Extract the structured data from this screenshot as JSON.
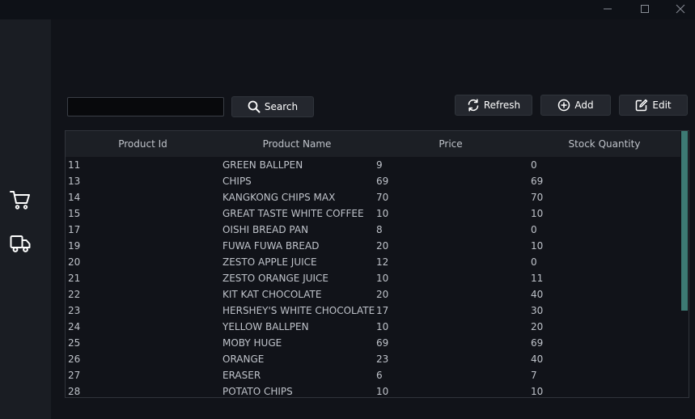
{
  "window_controls": {
    "minimize_icon": "minimize-icon",
    "maximize_icon": "maximize-icon",
    "close_icon": "close-icon"
  },
  "sidebar": {
    "items": [
      {
        "icon": "cart-icon"
      },
      {
        "icon": "truck-icon"
      }
    ]
  },
  "toolbar": {
    "search_value": "",
    "search_label": "Search",
    "refresh_label": "Refresh",
    "add_label": "Add",
    "edit_label": "Edit"
  },
  "table": {
    "columns": [
      "Product Id",
      "Product Name",
      "Price",
      "Stock Quantity"
    ],
    "rows": [
      [
        "11",
        "GREEN BALLPEN",
        "9",
        "0"
      ],
      [
        "13",
        "CHIPS",
        "69",
        "69"
      ],
      [
        "14",
        "KANGKONG CHIPS MAX",
        "70",
        "70"
      ],
      [
        "15",
        "GREAT TASTE WHITE COFFEE",
        "10",
        "10"
      ],
      [
        "17",
        "OISHI BREAD PAN",
        "8",
        "0"
      ],
      [
        "19",
        "FUWA FUWA BREAD",
        "20",
        "10"
      ],
      [
        "20",
        "ZESTO APPLE JUICE",
        "12",
        "0"
      ],
      [
        "21",
        "ZESTO ORANGE JUICE",
        "10",
        "11"
      ],
      [
        "22",
        "KIT KAT CHOCOLATE",
        "20",
        "40"
      ],
      [
        "23",
        "HERSHEY'S WHITE CHOCOLATE",
        "17",
        "30"
      ],
      [
        "24",
        "YELLOW BALLPEN",
        "10",
        "20"
      ],
      [
        "25",
        "MOBY HUGE",
        "69",
        "69"
      ],
      [
        "26",
        "ORANGE",
        "23",
        "40"
      ],
      [
        "27",
        "ERASER",
        "6",
        "7"
      ],
      [
        "28",
        "POTATO CHIPS",
        "10",
        "10"
      ]
    ]
  },
  "colors": {
    "accent_scrollbar": "#3d7a74",
    "background": "#111319",
    "sidebar": "#1a1d23"
  }
}
